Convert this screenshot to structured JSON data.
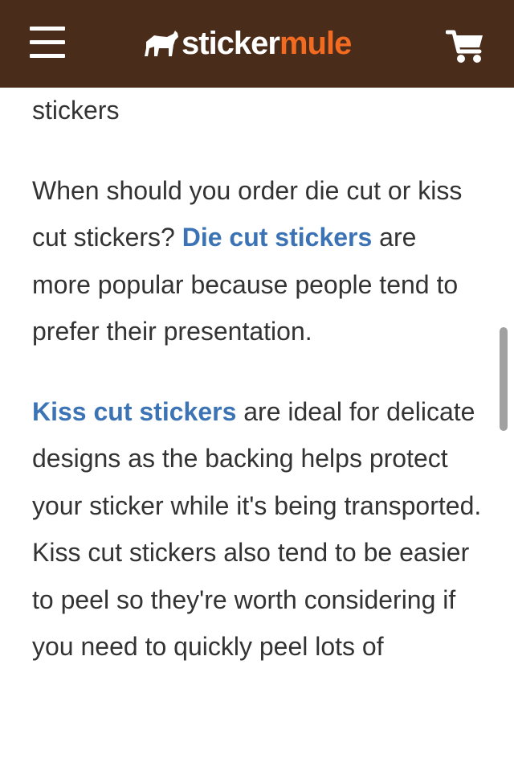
{
  "header": {
    "brand_part1": "sticker",
    "brand_part2": "mule",
    "colors": {
      "bar": "#4a2c1b",
      "brand_accent": "#f26b21",
      "link": "#3b73b5"
    },
    "icons": {
      "menu": "hamburger-menu-icon",
      "logo": "mule-logo-icon",
      "cart": "shopping-cart-icon"
    }
  },
  "article": {
    "p0": "stickers",
    "p1_before": "When should you order die cut or kiss cut stickers? ",
    "p1_link": "Die cut stickers",
    "p1_after": " are more popular because people tend to prefer their presentation.",
    "p2_link": "Kiss cut stickers",
    "p2_after": " are ideal for delicate designs as the backing helps protect your sticker while it's being transported. Kiss cut stickers also tend to be easier to peel so they're worth considering if you need to quickly peel lots of"
  }
}
